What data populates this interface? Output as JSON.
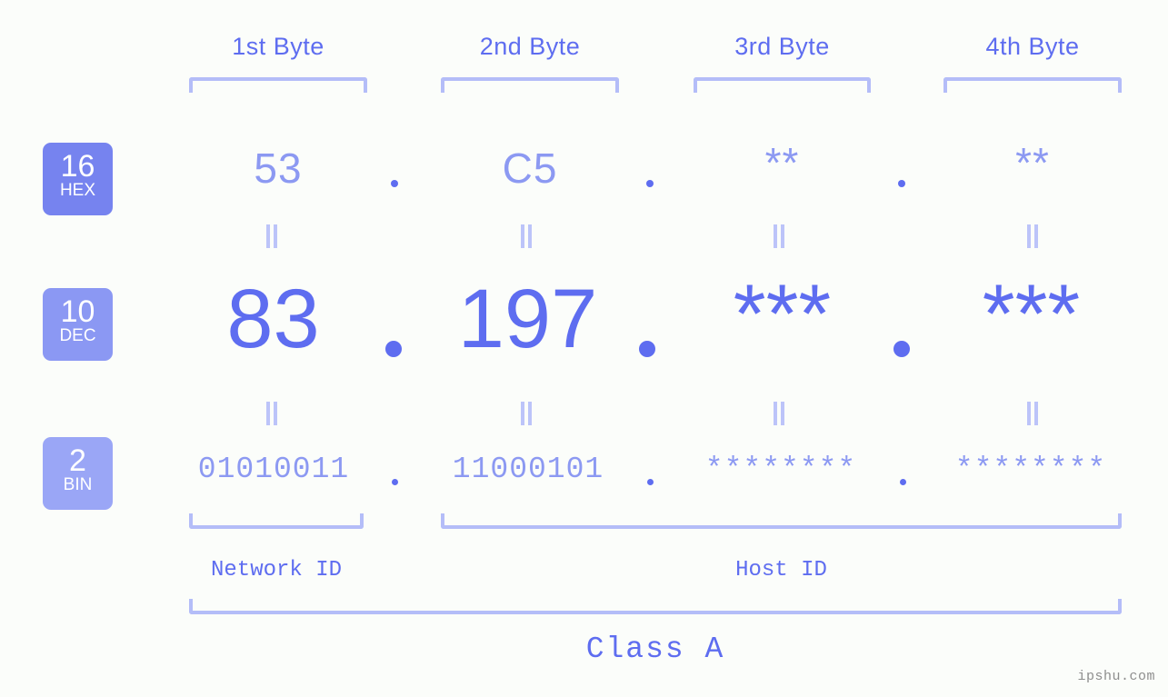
{
  "watermark": "ipshu.com",
  "byte_headers": [
    {
      "label": "1st Byte"
    },
    {
      "label": "2nd Byte"
    },
    {
      "label": "3rd Byte"
    },
    {
      "label": "4th Byte"
    }
  ],
  "radix_badges": [
    {
      "radix": "16",
      "name": "HEX",
      "color": "#7683ef"
    },
    {
      "radix": "10",
      "name": "DEC",
      "color": "#8b98f3"
    },
    {
      "radix": "2",
      "name": "BIN",
      "color": "#9aa6f6"
    }
  ],
  "rows": {
    "hex": {
      "values": [
        "53",
        "C5",
        "**",
        "**"
      ],
      "separator": "."
    },
    "dec": {
      "values": [
        "83",
        "197",
        "***",
        "***"
      ],
      "separator": "."
    },
    "bin": {
      "values": [
        "01010011",
        "11000101",
        "********",
        "********"
      ],
      "separator": "."
    }
  },
  "equals_symbol": "=",
  "spans": {
    "network_id": "Network ID",
    "host_id": "Host ID",
    "class": "Class A"
  },
  "colors": {
    "background": "#fbfdfa",
    "accent_strong": "#5e6df0",
    "accent_mid": "#8c99f2",
    "accent_light": "#b4bdf8",
    "watermark": "#8e8e8e"
  }
}
